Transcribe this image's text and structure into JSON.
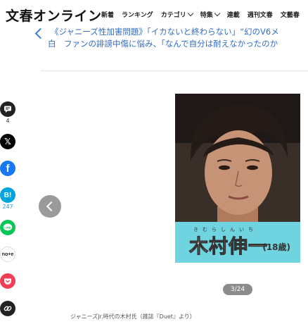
{
  "header": {
    "logo": "文春オンライン",
    "nav": [
      {
        "label": "新着",
        "dropdown": false
      },
      {
        "label": "ランキング",
        "dropdown": false
      },
      {
        "label": "カテゴリ",
        "dropdown": true
      },
      {
        "label": "特集",
        "dropdown": true
      },
      {
        "label": "連載",
        "dropdown": false
      },
      {
        "label": "週刊文春",
        "dropdown": false
      },
      {
        "label": "文藝春",
        "dropdown": false
      }
    ]
  },
  "article": {
    "title_line1": "《ジャニーズ性加害問題》「イカないと終わらない」“幻のV6メ",
    "title_line2": "白　ファンの誹謗中傷に悩み、「なんで自分は耐えなかったのか"
  },
  "share": {
    "comment_count": "4",
    "hatena_count": "247",
    "colors": {
      "comment": "#222222",
      "x": "#000000",
      "facebook": "#1877f2",
      "hatena": "#00a4de",
      "line": "#06c755",
      "note": "#ffffff",
      "pocket": "#ef3f56",
      "link": "#222222"
    }
  },
  "gallery": {
    "photo_name": "木村伸一",
    "photo_furigana": "きむらしんいち",
    "photo_age": "(18歳)",
    "counter": "3/24",
    "caption": "ジャニーズJr.時代の木村氏（雑誌『Duet』より）"
  }
}
